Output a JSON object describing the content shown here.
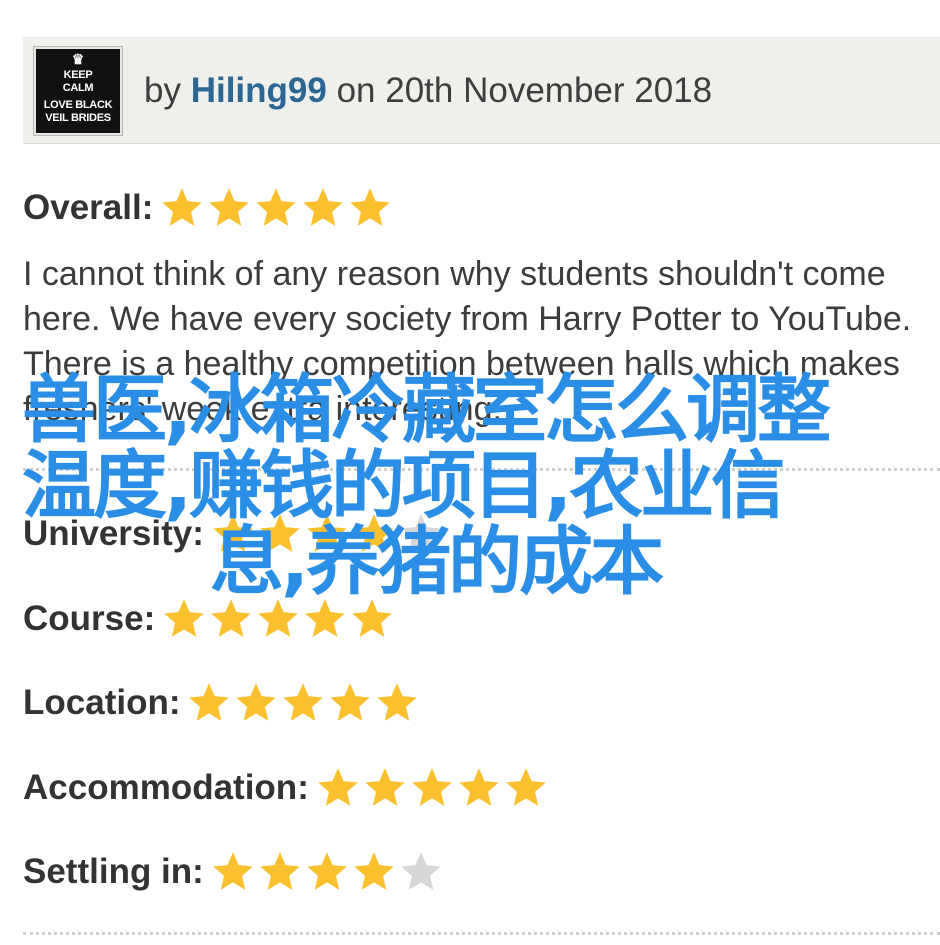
{
  "review": {
    "avatar": {
      "crown": "♛",
      "lines": [
        "KEEP",
        "CALM",
        "LOVE BLACK",
        "VEIL BRIDES"
      ]
    },
    "by_prefix": "by",
    "author": "Hiling99",
    "date_text": "on 20th November 2018",
    "overall": {
      "label": "Overall:",
      "stars": 5,
      "max_stars": 5
    },
    "text": "I cannot think of any reason why students shouldn't come here. We have every society from Harry Potter to YouTube. There is a healthy competition between halls which makes freshers' week extra interesting.",
    "categories": [
      {
        "label": "University:",
        "stars": 4,
        "max_stars": 5
      },
      {
        "label": "Course:",
        "stars": 5,
        "max_stars": 5
      },
      {
        "label": "Location:",
        "stars": 5,
        "max_stars": 5
      },
      {
        "label": "Accommodation:",
        "stars": 5,
        "max_stars": 5
      },
      {
        "label": "Settling in:",
        "stars": 4,
        "max_stars": 5
      }
    ]
  },
  "watermark": {
    "lines": [
      "兽医,冰箱冷藏室怎么调整",
      "温度,赚钱的项目,农业信",
      "息,养猪的成本"
    ]
  },
  "colors": {
    "star_filled": "#fbc02d",
    "star_empty": "#d7d7d7",
    "author_link": "#2c6794",
    "header_bg": "#efefec",
    "watermark": "#2a8ee6"
  }
}
